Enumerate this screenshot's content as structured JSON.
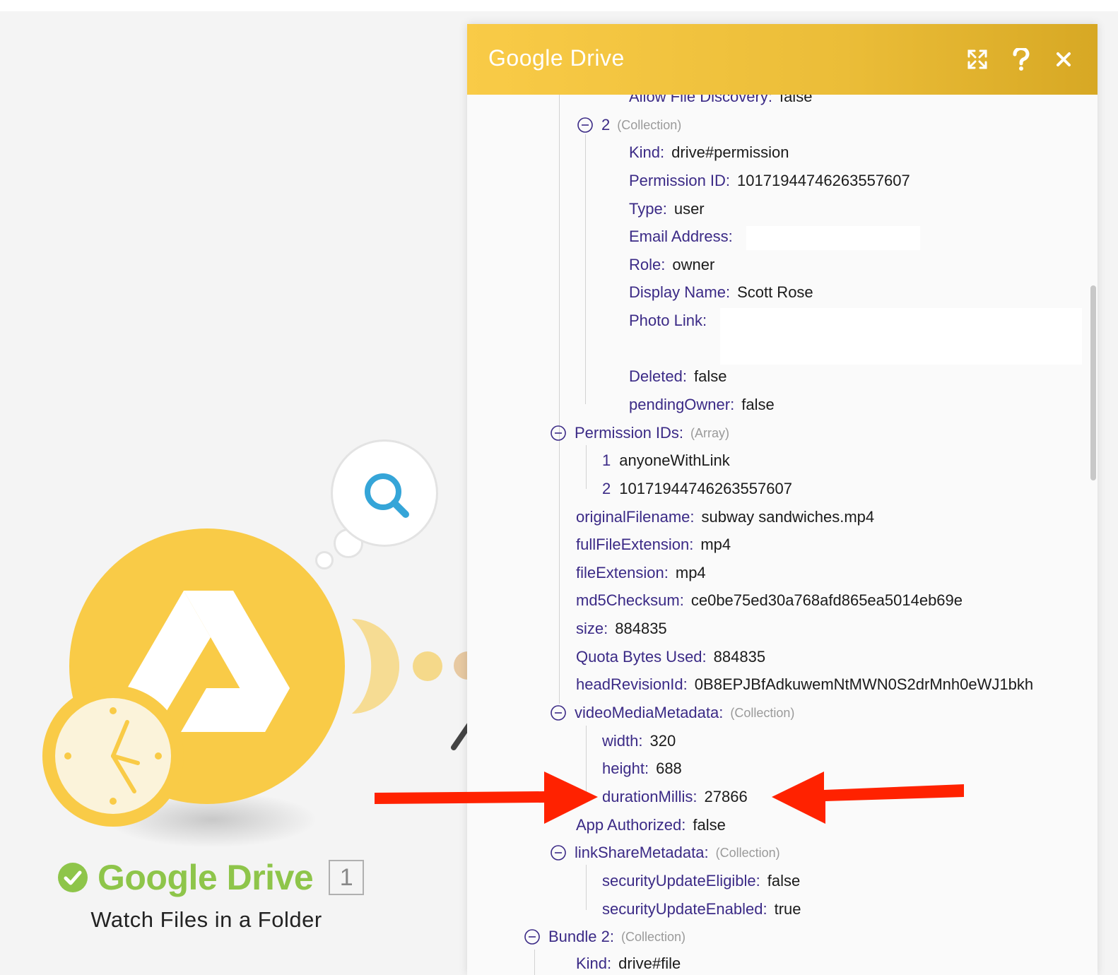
{
  "module": {
    "title": "Google Drive",
    "subtitle": "Watch Files in a Folder",
    "count": "1"
  },
  "panel": {
    "title": "Google Drive",
    "rows": {
      "allow_discovery": {
        "key": "Allow File Discovery",
        "value": "false"
      },
      "perm2": {
        "key": "2",
        "type": "(Collection)"
      },
      "kind": {
        "key": "Kind",
        "value": "drive#permission"
      },
      "perm_id": {
        "key": "Permission ID",
        "value": "10171944746263557607"
      },
      "type": {
        "key": "Type",
        "value": "user"
      },
      "email": {
        "key": "Email Address",
        "value": ""
      },
      "role": {
        "key": "Role",
        "value": "owner"
      },
      "display_name": {
        "key": "Display Name",
        "value": "Scott Rose"
      },
      "photo_link": {
        "key": "Photo Link",
        "value": ""
      },
      "deleted": {
        "key": "Deleted",
        "value": "false"
      },
      "pending_owner": {
        "key": "pendingOwner",
        "value": "false"
      },
      "perm_ids": {
        "key": "Permission IDs",
        "type": "(Array)"
      },
      "perm_ids_1": {
        "key": "1",
        "value": "anyoneWithLink"
      },
      "perm_ids_2": {
        "key": "2",
        "value": "10171944746263557607"
      },
      "original_filename": {
        "key": "originalFilename",
        "value": "subway sandwiches.mp4"
      },
      "full_ext": {
        "key": "fullFileExtension",
        "value": "mp4"
      },
      "file_ext": {
        "key": "fileExtension",
        "value": "mp4"
      },
      "md5": {
        "key": "md5Checksum",
        "value": "ce0be75ed30a768afd865ea5014eb69e"
      },
      "size": {
        "key": "size",
        "value": "884835"
      },
      "quota": {
        "key": "Quota Bytes Used",
        "value": "884835"
      },
      "head_rev": {
        "key": "headRevisionId",
        "value": "0B8EPJBfAdkuwemNtMWN0S2drMnh0eWJ1bkh"
      },
      "video_meta": {
        "key": "videoMediaMetadata",
        "type": "(Collection)"
      },
      "width": {
        "key": "width",
        "value": "320"
      },
      "height": {
        "key": "height",
        "value": "688"
      },
      "duration": {
        "key": "durationMillis",
        "value": "27866"
      },
      "app_auth": {
        "key": "App Authorized",
        "value": "false"
      },
      "link_share": {
        "key": "linkShareMetadata",
        "type": "(Collection)"
      },
      "sec_eligible": {
        "key": "securityUpdateEligible",
        "value": "false"
      },
      "sec_enabled": {
        "key": "securityUpdateEnabled",
        "value": "true"
      },
      "bundle2": {
        "key": "Bundle 2",
        "type": "(Collection)"
      },
      "kind2": {
        "key": "Kind",
        "value": "drive#file"
      }
    }
  },
  "colors": {
    "module_yellow": "#f9cb47",
    "success_green": "#8ec54a",
    "key_purple": "#3b2a86",
    "arrow_red": "#ff2200"
  },
  "icons": [
    "google-drive-logo-icon",
    "clock-icon",
    "search-icon",
    "check-circle-icon",
    "expand-icon",
    "help-icon",
    "close-icon",
    "collapse-minus-icon",
    "wrench-icon"
  ]
}
